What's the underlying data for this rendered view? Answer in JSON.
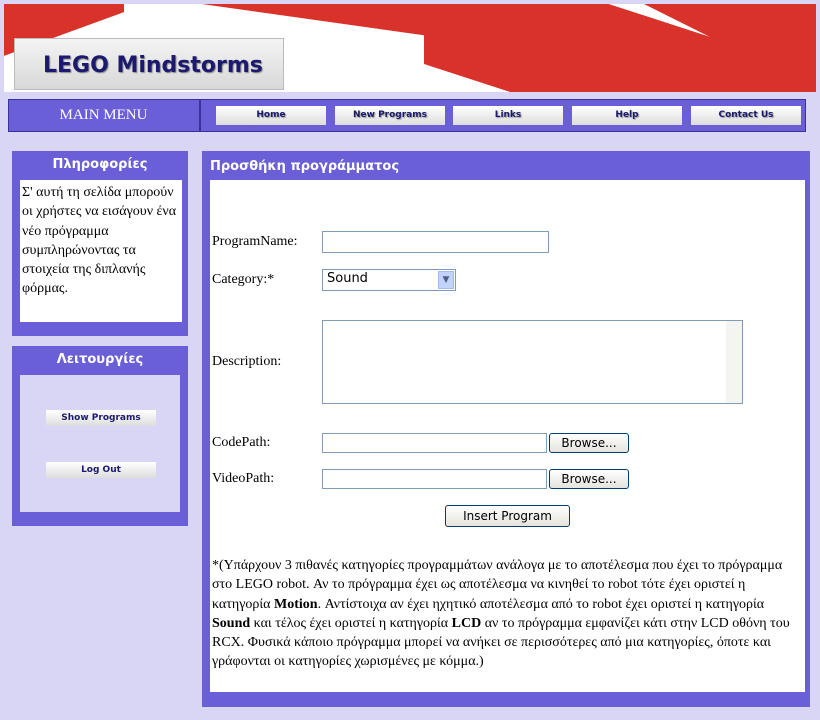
{
  "header": {
    "logo_text": "LEGO Mindstorms"
  },
  "nav": {
    "main_menu": "MAIN MENU",
    "items": [
      {
        "label": "Home"
      },
      {
        "label": "New Programs"
      },
      {
        "label": "Links"
      },
      {
        "label": "Help"
      },
      {
        "label": "Contact Us"
      }
    ]
  },
  "sidebar": {
    "info_title": "Πληροφορίες",
    "info_text": "Σ' αυτή τη σελίδα μπορούν οι χρήστες να εισάγουν ένα νέο πρόγραμμα συμπληρώνοντας τα στοιχεία της διπλανής φόρμας.",
    "functions_title": "Λειτουργίες",
    "show_programs": "Show Programs",
    "log_out": "Log Out"
  },
  "form": {
    "title": "Προσθήκη προγράμματος",
    "program_name_label": "ProgramName:",
    "program_name_value": "",
    "category_label": "Category:*",
    "category_value": "Sound",
    "description_label": "Description:",
    "codepath_label": "CodePath:",
    "videopath_label": "VideoPath:",
    "browse": "Browse...",
    "insert": "Insert Program"
  },
  "note": {
    "p1": "*(Υπάρχουν 3 πιθανές κατηγορίες προγραμμάτων ανάλογα με το αποτέλεσμα που έχει το πρόγραμμα στο LEGO robot. Αν το πρόγραμμα έχει ως αποτέλεσμα να κινηθεί το robot τότε έχει οριστεί η κατηγορία ",
    "motion": "Motion",
    "p2": ". Αντίστοιχα αν έχει ηχητικό αποτέλεσμα από το robot έχει οριστεί η κατηγορία ",
    "sound": "Sound",
    "p3": " και τέλος έχει οριστεί η κατηγορία ",
    "lcd": "LCD",
    "p4": " αν το πρόγραμμα εμφανίζει κάτι στην LCD οθόνη του RCX. Φυσικά κάποιο πρόγραμμα μπορεί να ανήκει σε περισσότερες από μια κατηγορίες, όποτε και γράφονται οι κατηγορίες χωρισμένες με κόμμα.)"
  },
  "colors": {
    "panel": "#6a5fd6",
    "background": "#d9d6f5",
    "brick": "#d8322a"
  }
}
